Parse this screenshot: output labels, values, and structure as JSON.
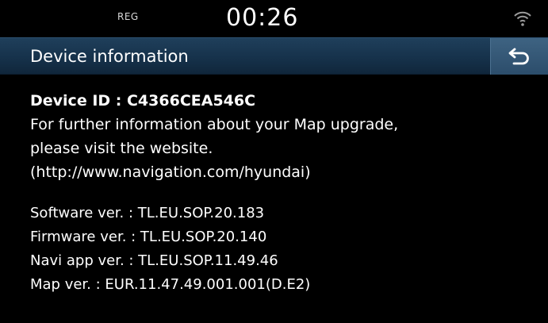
{
  "status_bar": {
    "reg_label": "REG",
    "clock": "00:26",
    "signal_icon": "wifi-signal-icon"
  },
  "header": {
    "title": "Device information",
    "back_icon": "back-arrow-icon"
  },
  "content": {
    "device_id": "Device ID : C4366CEA546C",
    "info_lines": [
      "For further information about your Map upgrade,",
      "please visit the website.",
      "(http://www.navigation.com/hyundai)"
    ],
    "versions": [
      "Software ver. : TL.EU.SOP.20.183",
      "Firmware ver. : TL.EU.SOP.20.140",
      "Navi app ver. : TL.EU.SOP.11.49.46",
      "Map ver. : EUR.11.47.49.001.001(D.E2)"
    ]
  },
  "colors": {
    "background": "#000000",
    "header": "#16324b",
    "back_button": "#2c4d6b",
    "text": "#ffffff"
  }
}
